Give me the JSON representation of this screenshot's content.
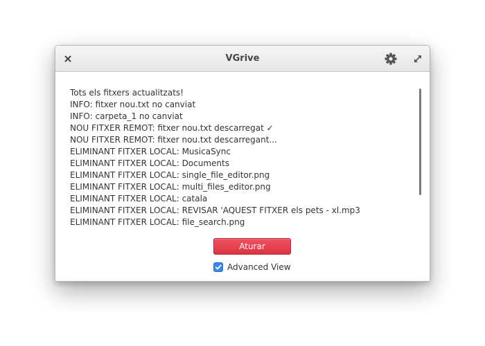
{
  "window": {
    "title": "VGrive",
    "icons": {
      "close": "close-icon",
      "settings": "gear-icon",
      "maximize": "maximize-icon"
    }
  },
  "log": {
    "lines": [
      "Tots els fitxers actualitzats!",
      "INFO: fitxer nou.txt no canviat",
      "INFO: carpeta_1 no canviat",
      "NOU FITXER REMOT: fitxer nou.txt descarregat ✓",
      "NOU FITXER REMOT: fitxer nou.txt descarregant...",
      "ELIMINANT FITXER LOCAL: MusicaSync",
      "ELIMINANT FITXER LOCAL: Documents",
      "ELIMINANT FITXER LOCAL: single_file_editor.png",
      "ELIMINANT FITXER LOCAL: multi_files_editor.png",
      "ELIMINANT FITXER LOCAL: catala",
      "ELIMINANT FITXER LOCAL: REVISAR 'AQUEST FITXER els pets - xl.mp3",
      "ELIMINANT FITXER LOCAL: file_search.png"
    ]
  },
  "controls": {
    "stop_label": "Aturar",
    "stop_color": "#ed4052",
    "advanced_view_label": "Advanced View",
    "advanced_view_checked": true,
    "accent_color": "#3689e6"
  }
}
